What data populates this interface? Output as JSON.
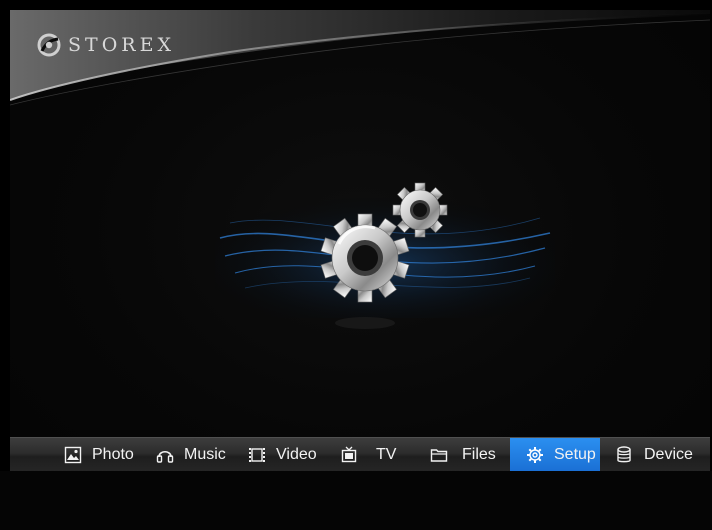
{
  "brand": {
    "logo_text": "STOREX",
    "logo_icon": "storex-swirl-icon"
  },
  "center": {
    "icon": "gears-icon"
  },
  "menu": {
    "items": [
      {
        "label": "Photo",
        "icon": "photo-icon",
        "selected": false
      },
      {
        "label": "Music",
        "icon": "headphones-icon",
        "selected": false
      },
      {
        "label": "Video",
        "icon": "film-icon",
        "selected": false
      },
      {
        "label": "TV",
        "icon": "tv-icon",
        "selected": false
      },
      {
        "label": "Files",
        "icon": "folder-icon",
        "selected": false
      },
      {
        "label": "Setup",
        "icon": "gear-icon",
        "selected": true
      },
      {
        "label": "Device",
        "icon": "device-icon",
        "selected": false
      }
    ],
    "selected_color": "#1f7fe6"
  }
}
